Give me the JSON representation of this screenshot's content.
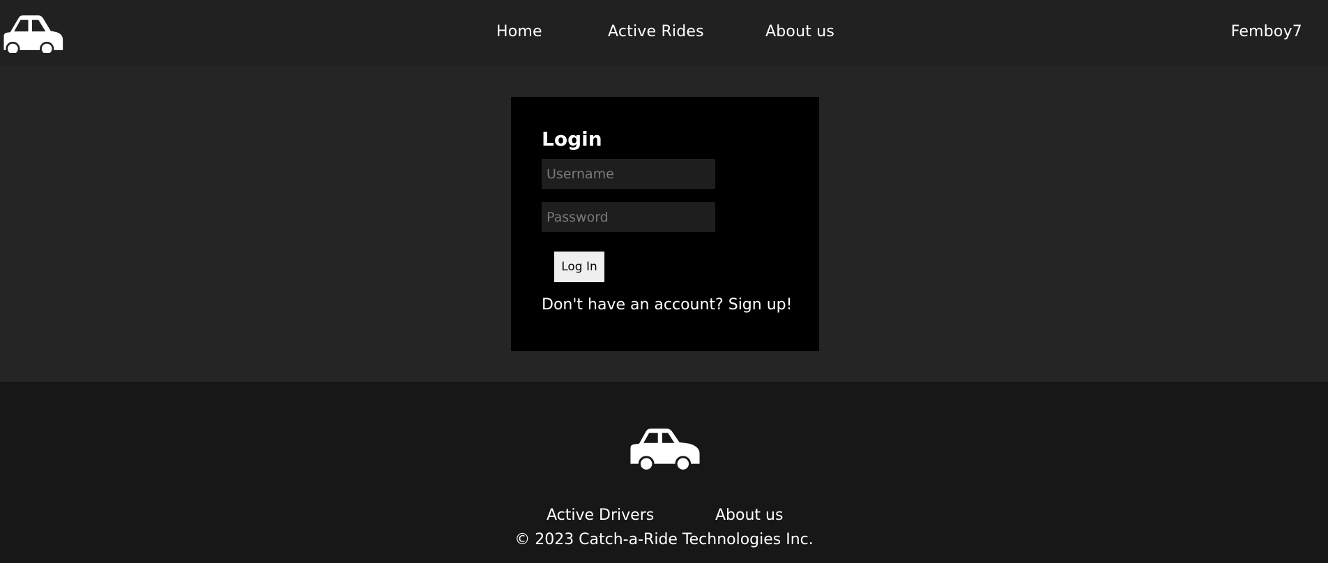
{
  "header": {
    "logo_icon": "car-icon",
    "nav": {
      "home": "Home",
      "active_rides": "Active Rides",
      "about": "About us"
    },
    "username": "Femboy7"
  },
  "login": {
    "title": "Login",
    "username_placeholder": "Username",
    "username_value": "",
    "password_placeholder": "Password",
    "password_value": "",
    "submit_label": "Log In",
    "signup_prompt": "Don't have an account?",
    "signup_link": "Sign up!"
  },
  "footer": {
    "logo_icon": "car-icon",
    "links": {
      "active_drivers": "Active Drivers",
      "about": "About us"
    },
    "copyright": "© 2023 Catch-a-Ride Technologies Inc."
  },
  "colors": {
    "header_bg": "#212121",
    "page_bg": "#252525",
    "card_bg": "#000000",
    "input_bg": "#1e1e1e",
    "button_bg": "#efefef",
    "footer_bg": "#171717",
    "text": "#ffffff"
  }
}
